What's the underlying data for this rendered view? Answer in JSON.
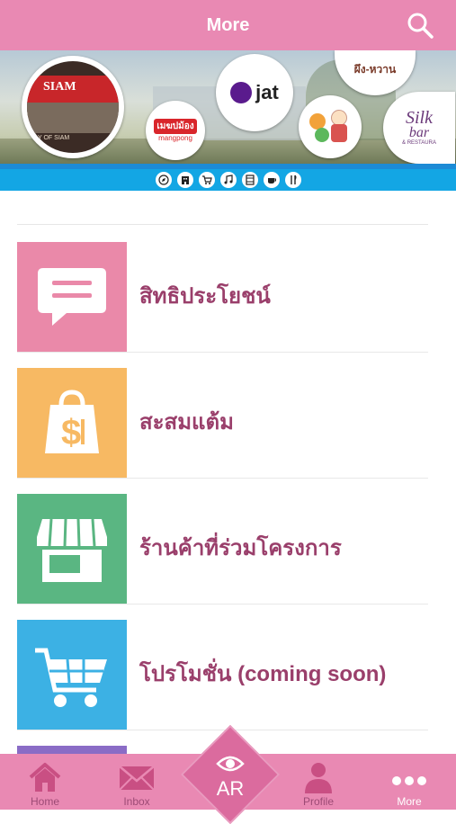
{
  "header": {
    "title": "More",
    "search_icon": "search-icon"
  },
  "banner": {
    "logos": {
      "siam": {
        "top": "SIAM",
        "caption": "Y OF SIAM"
      },
      "mangpong": {
        "thai": "เมฆปม้อง",
        "latin": "mangpong"
      },
      "jat": {
        "text": "jat"
      },
      "phungwan": {
        "text": "ผึง-หวาน"
      },
      "silk": {
        "word1": "Silk",
        "word2": "bar",
        "caption": "& RESTAURA"
      }
    },
    "strip_icons": [
      "compass-icon",
      "building-icon",
      "cart-icon",
      "music-icon",
      "film-icon",
      "coffee-icon",
      "cutlery-icon"
    ]
  },
  "menu": [
    {
      "label": "สิทธิประโยชน์",
      "color": "#ea89a9",
      "icon": "chat-bubble-icon"
    },
    {
      "label": "สะสมแต้ม",
      "color": "#f7b963",
      "icon": "shopping-bag-icon"
    },
    {
      "label": "ร้านค้าที่ร่วมโครงการ",
      "color": "#5ab682",
      "icon": "storefront-icon"
    },
    {
      "label": "โปรโมชั่น (coming soon)",
      "color": "#3cb1e4",
      "icon": "shopping-cart-icon"
    }
  ],
  "tabbar": {
    "home": "Home",
    "inbox": "Inbox",
    "ar": "AR",
    "profile": "Profile",
    "more": "More"
  },
  "colors": {
    "accent": "#e989b3",
    "label": "#9a3f6b",
    "tab_text": "#9d4a75"
  }
}
